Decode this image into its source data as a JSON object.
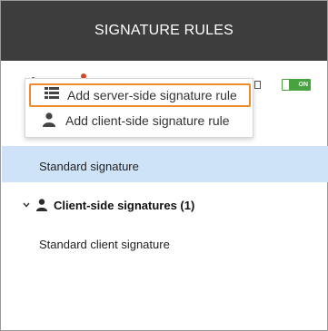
{
  "header": {
    "title": "SIGNATURE RULES"
  },
  "toolbar": {
    "toggle_label": "ON"
  },
  "menu": {
    "items": [
      {
        "label": "Add server-side signature rule",
        "icon": "server-grid-icon"
      },
      {
        "label": "Add client-side signature rule",
        "icon": "person-icon"
      }
    ]
  },
  "groups": [
    {
      "label": "",
      "items": [
        {
          "label": "Standard signature",
          "selected": true
        }
      ]
    },
    {
      "label": "Client-side signatures (1)",
      "items": [
        {
          "label": "Standard client signature",
          "selected": false
        }
      ]
    }
  ],
  "colors": {
    "header_bg": "#3d3d3d",
    "accent_orange": "#f08a2c",
    "toggle_green": "#47a23f",
    "selected_row": "#cfe3f8"
  }
}
